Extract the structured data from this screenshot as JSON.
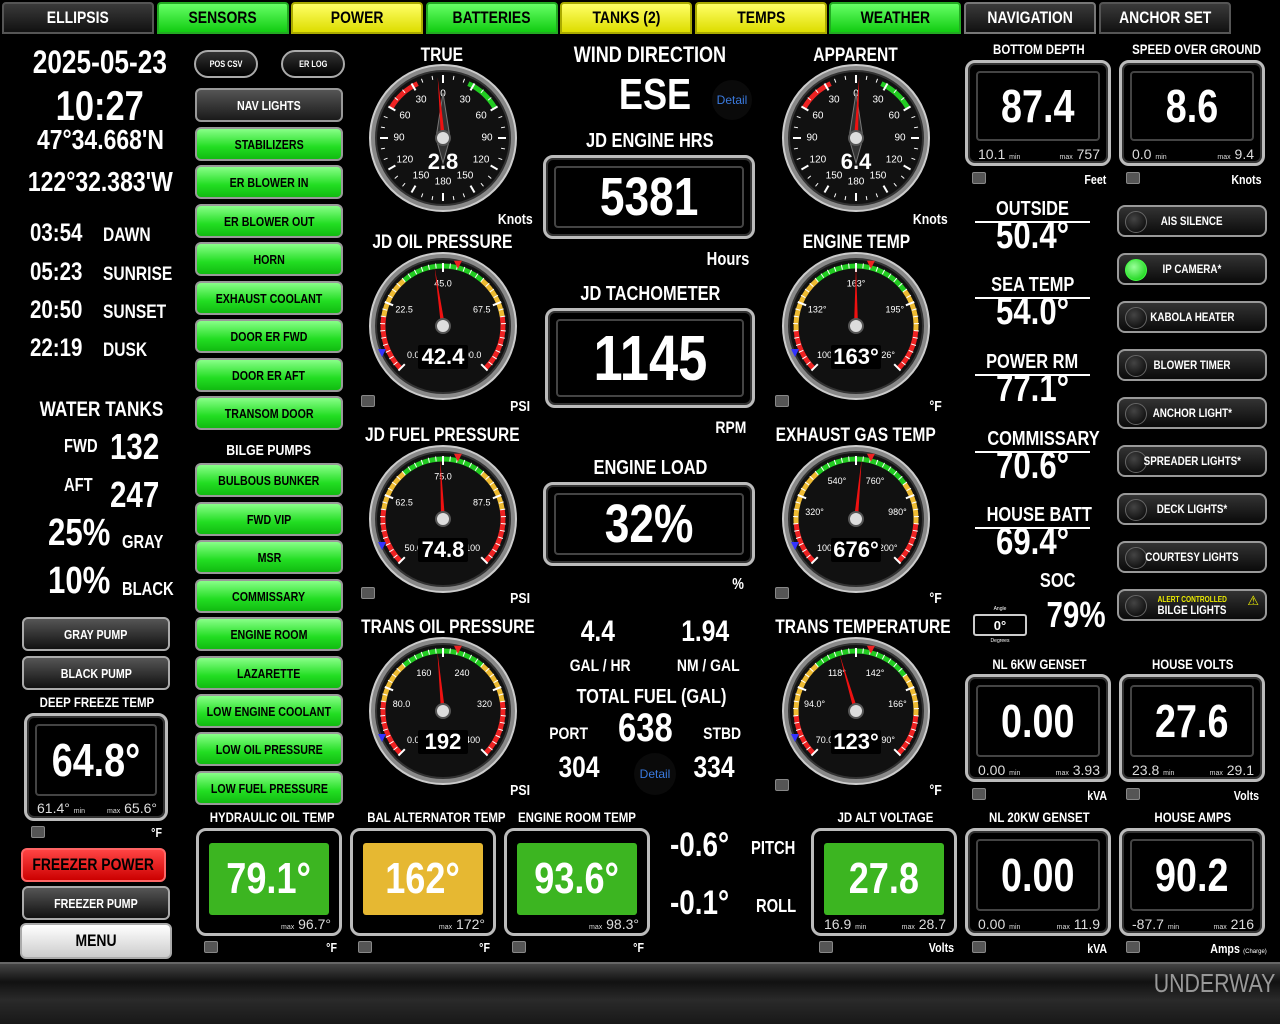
{
  "tabs": [
    {
      "label": "ELLIPSIS",
      "style": "dark"
    },
    {
      "label": "SENSORS",
      "style": "green"
    },
    {
      "label": "POWER",
      "style": "yellow"
    },
    {
      "label": "BATTERIES",
      "style": "green"
    },
    {
      "label": "TANKS (2)",
      "style": "yellow"
    },
    {
      "label": "TEMPS",
      "style": "yellow"
    },
    {
      "label": "WEATHER",
      "style": "green"
    },
    {
      "label": "NAVIGATION",
      "style": "dark"
    },
    {
      "label": "ANCHOR SET",
      "style": "dark"
    }
  ],
  "info": {
    "date": "2025-05-23",
    "time": "10:27",
    "lat": "47°34.668'N",
    "lon": "122°32.383'W",
    "sun": [
      {
        "time": "03:54",
        "label": "DAWN"
      },
      {
        "time": "05:23",
        "label": "SUNRISE"
      },
      {
        "time": "20:50",
        "label": "SUNSET"
      },
      {
        "time": "22:19",
        "label": "DUSK"
      }
    ]
  },
  "water_tanks": {
    "title": "WATER TANKS",
    "fwd_label": "FWD",
    "fwd": "132",
    "aft_label": "AFT",
    "aft": "247",
    "gray": "25%",
    "gray_label": "GRAY",
    "black": "10%",
    "black_label": "BLACK"
  },
  "pumps": {
    "gray": "GRAY PUMP",
    "black": "BLACK PUMP"
  },
  "deep_freeze": {
    "title": "DEEP FREEZE TEMP",
    "value": "64.8°",
    "min": "61.4°",
    "max": "65.6°",
    "unit": "°F",
    "min_label": "min",
    "max_label": "max"
  },
  "freezer_power": "FREEZER POWER",
  "freezer_pump": "FREEZER PUMP",
  "menu": "MENU",
  "small_buttons": {
    "pos_csv": "POS CSV",
    "er_log": "ER LOG"
  },
  "light_buttons": [
    {
      "label": "NAV LIGHTS",
      "style": "d"
    },
    {
      "label": "STABILIZERS",
      "style": "g"
    },
    {
      "label": "ER BLOWER IN",
      "style": "g"
    },
    {
      "label": "ER BLOWER OUT",
      "style": "g"
    },
    {
      "label": "HORN",
      "style": "g"
    },
    {
      "label": "EXHAUST COOLANT",
      "style": "g"
    },
    {
      "label": "DOOR ER FWD",
      "style": "g"
    },
    {
      "label": "DOOR ER AFT",
      "style": "g"
    },
    {
      "label": "TRANSOM DOOR",
      "style": "g"
    }
  ],
  "bilge_title": "BILGE PUMPS",
  "bilge_buttons": [
    "BULBOUS BUNKER",
    "FWD VIP",
    "MSR",
    "COMMISSARY",
    "ENGINE ROOM",
    "LAZARETTE",
    "LOW ENGINE COOLANT",
    "LOW OIL PRESSURE",
    "LOW FUEL PRESSURE"
  ],
  "gauges": {
    "true_wind": {
      "title": "TRUE",
      "value": "2.8",
      "unit": "Knots",
      "angle": -5,
      "ticks": [
        "0",
        "30",
        "30",
        "60",
        "60",
        "90",
        "90",
        "120",
        "120",
        "150",
        "150",
        "180"
      ]
    },
    "apparent_wind": {
      "title": "APPARENT",
      "value": "6.4",
      "unit": "Knots",
      "angle": 3,
      "ticks": [
        "0",
        "30",
        "30",
        "60",
        "60",
        "90",
        "90",
        "120",
        "120",
        "150",
        "150",
        "180"
      ]
    },
    "oil_pressure": {
      "title": "JD OIL PRESSURE",
      "value": "42.4",
      "unit": "PSI",
      "ticks": [
        "0.0",
        "22.5",
        "45.0",
        "67.5",
        "90.0"
      ],
      "level": 0.47
    },
    "fuel_pressure": {
      "title": "JD FUEL PRESSURE",
      "value": "74.8",
      "unit": "PSI",
      "ticks": [
        "50.0",
        "62.5",
        "75.0",
        "87.5",
        "100"
      ],
      "level": 0.49
    },
    "trans_oil": {
      "title": "TRANS OIL PRESSURE",
      "value": "192",
      "unit": "PSI",
      "ticks": [
        "0.0",
        "80.0",
        "160",
        "240",
        "320",
        "400"
      ],
      "level": 0.48
    },
    "engine_temp": {
      "title": "ENGINE TEMP",
      "value": "163°",
      "unit": "°F",
      "ticks": [
        "100°",
        "132°",
        "163°",
        "195°",
        "226°"
      ],
      "level": 0.5
    },
    "exhaust_gas": {
      "title": "EXHAUST GAS TEMP",
      "value": "676°",
      "unit": "°F",
      "ticks": [
        "100°",
        "320°",
        "540°",
        "760°",
        "980°",
        "1200°"
      ],
      "level": 0.52
    },
    "trans_temp": {
      "title": "TRANS TEMPERATURE",
      "value": "123°",
      "unit": "°F",
      "ticks": [
        "70.0°",
        "94.0°",
        "118°",
        "142°",
        "166°",
        "190°"
      ],
      "level": 0.44
    }
  },
  "wind_direction": {
    "title": "WIND DIRECTION",
    "value": "ESE",
    "detail": "Detail"
  },
  "engine_hrs": {
    "title": "JD ENGINE HRS",
    "value": "5381",
    "unit": "Hours"
  },
  "tachometer": {
    "title": "JD TACHOMETER",
    "value": "1145",
    "unit": "RPM"
  },
  "engine_load": {
    "title": "ENGINE LOAD",
    "value": "32%",
    "unit": "%"
  },
  "fuel": {
    "gal_hr": "4.4",
    "gal_hr_label": "GAL / HR",
    "nm_gal": "1.94",
    "nm_gal_label": "NM / GAL",
    "total_title": "TOTAL FUEL (GAL)",
    "total": "638",
    "port_label": "PORT",
    "port": "304",
    "stbd_label": "STBD",
    "stbd": "334",
    "detail": "Detail"
  },
  "pitch": {
    "value": "-0.6°",
    "label": "PITCH"
  },
  "roll": {
    "value": "-0.1°",
    "label": "ROLL"
  },
  "bottom_tiles": [
    {
      "title": "HYDRAULIC OIL TEMP",
      "value": "79.1°",
      "max": "96.7°",
      "unit": "°F",
      "color": "#3cb521"
    },
    {
      "title": "BAL ALTERNATOR TEMP",
      "value": "162°",
      "max": "172°",
      "unit": "°F",
      "color": "#e6b832"
    },
    {
      "title": "ENGINE ROOM TEMP",
      "value": "93.6°",
      "max": "98.3°",
      "unit": "°F",
      "color": "#3cb521"
    },
    {
      "title": "JD ALT VOLTAGE",
      "value": "27.8",
      "min": "16.9",
      "max": "28.7",
      "unit": "Volts",
      "color": "#3cb521"
    }
  ],
  "right_boxes": [
    {
      "title": "BOTTOM DEPTH",
      "value": "87.4",
      "min": "10.1",
      "max": "757",
      "unit": "Feet"
    },
    {
      "title": "SPEED OVER GROUND",
      "value": "8.6",
      "min": "0.0",
      "max": "9.4",
      "unit": "Knots"
    },
    {
      "title": "NL 6KW GENSET",
      "value": "0.00",
      "min": "0.00",
      "max": "3.93",
      "unit": "kVA"
    },
    {
      "title": "HOUSE VOLTS",
      "value": "27.6",
      "min": "23.8",
      "max": "29.1",
      "unit": "Volts"
    },
    {
      "title": "NL 20KW GENSET",
      "value": "0.00",
      "min": "0.00",
      "max": "11.9",
      "unit": "kVA"
    },
    {
      "title": "HOUSE AMPS",
      "value": "90.2",
      "min": "-87.7",
      "max": "216",
      "unit": "Amps",
      "unit_note": "(Charge)"
    }
  ],
  "temps": [
    {
      "label": "OUTSIDE",
      "value": "50.4°"
    },
    {
      "label": "SEA TEMP",
      "value": "54.0°"
    },
    {
      "label": "POWER RM",
      "value": "77.1°"
    },
    {
      "label": "COMMISSARY",
      "value": "70.6°"
    },
    {
      "label": "HOUSE BATT",
      "value": "69.4°"
    }
  ],
  "soc": {
    "label": "SOC",
    "value": "79%"
  },
  "angle_box": {
    "label": "Angle",
    "value": "0°",
    "unit": "Degrees"
  },
  "right_buttons": [
    {
      "label": "AIS SILENCE",
      "on": false
    },
    {
      "label": "IP CAMERA*",
      "on": true
    },
    {
      "label": "KABOLA HEATER",
      "on": false
    },
    {
      "label": "BLOWER TIMER",
      "on": false
    },
    {
      "label": "ANCHOR LIGHT*",
      "on": false
    },
    {
      "label": "SPREADER LIGHTS*",
      "on": false
    },
    {
      "label": "DECK LIGHTS*",
      "on": false
    },
    {
      "label": "COURTESY LIGHTS",
      "on": false
    },
    {
      "label": "BILGE LIGHTS",
      "on": false,
      "note": "ALERT CONTROLLED"
    }
  ],
  "status": "UNDERWAY",
  "colors": {
    "green": "#33dd33",
    "yellow": "#eeee22",
    "red": "#ee1111",
    "amber": "#e6b832"
  }
}
